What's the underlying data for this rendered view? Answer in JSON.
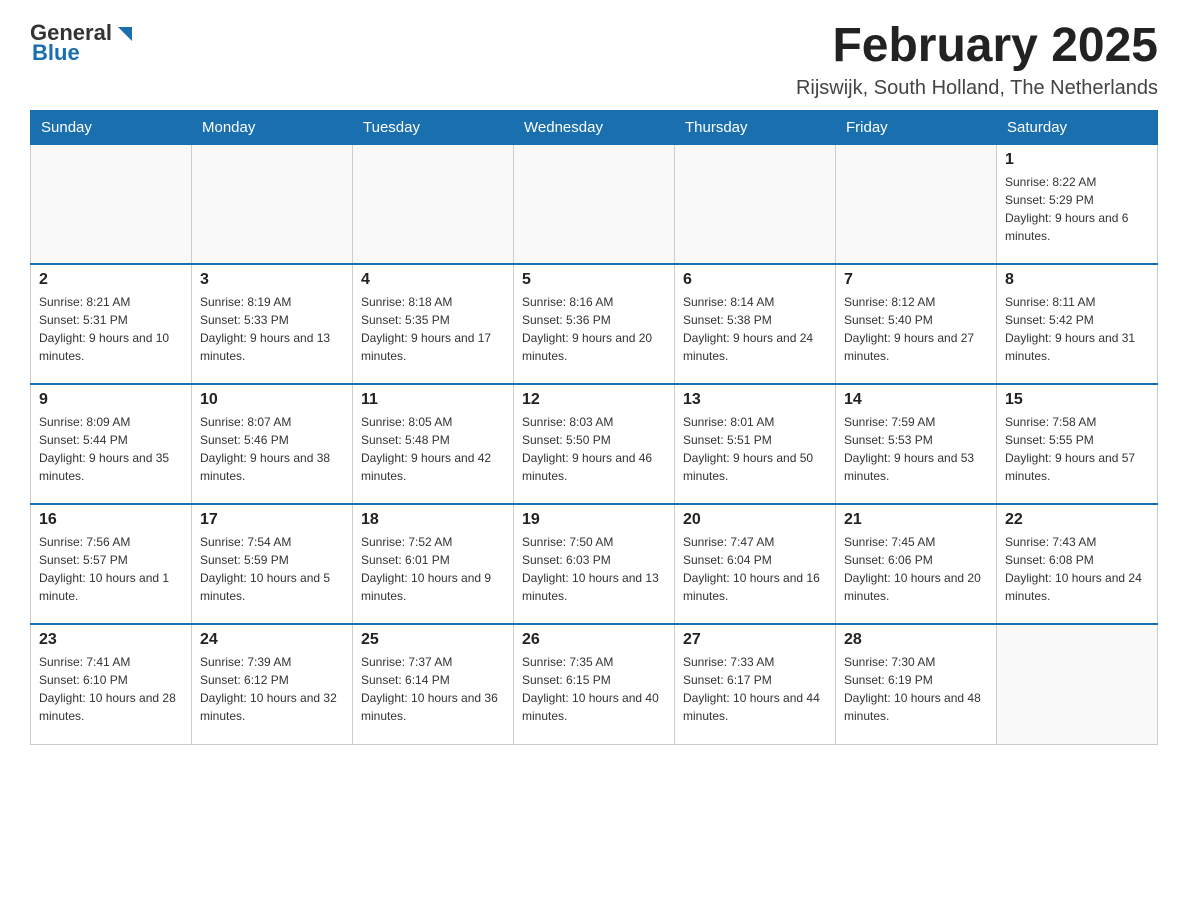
{
  "logo": {
    "general": "General",
    "blue": "Blue"
  },
  "title": "February 2025",
  "subtitle": "Rijswijk, South Holland, The Netherlands",
  "weekdays": [
    "Sunday",
    "Monday",
    "Tuesday",
    "Wednesday",
    "Thursday",
    "Friday",
    "Saturday"
  ],
  "weeks": [
    [
      {
        "day": "",
        "sunrise": "",
        "sunset": "",
        "daylight": ""
      },
      {
        "day": "",
        "sunrise": "",
        "sunset": "",
        "daylight": ""
      },
      {
        "day": "",
        "sunrise": "",
        "sunset": "",
        "daylight": ""
      },
      {
        "day": "",
        "sunrise": "",
        "sunset": "",
        "daylight": ""
      },
      {
        "day": "",
        "sunrise": "",
        "sunset": "",
        "daylight": ""
      },
      {
        "day": "",
        "sunrise": "",
        "sunset": "",
        "daylight": ""
      },
      {
        "day": "1",
        "sunrise": "Sunrise: 8:22 AM",
        "sunset": "Sunset: 5:29 PM",
        "daylight": "Daylight: 9 hours and 6 minutes."
      }
    ],
    [
      {
        "day": "2",
        "sunrise": "Sunrise: 8:21 AM",
        "sunset": "Sunset: 5:31 PM",
        "daylight": "Daylight: 9 hours and 10 minutes."
      },
      {
        "day": "3",
        "sunrise": "Sunrise: 8:19 AM",
        "sunset": "Sunset: 5:33 PM",
        "daylight": "Daylight: 9 hours and 13 minutes."
      },
      {
        "day": "4",
        "sunrise": "Sunrise: 8:18 AM",
        "sunset": "Sunset: 5:35 PM",
        "daylight": "Daylight: 9 hours and 17 minutes."
      },
      {
        "day": "5",
        "sunrise": "Sunrise: 8:16 AM",
        "sunset": "Sunset: 5:36 PM",
        "daylight": "Daylight: 9 hours and 20 minutes."
      },
      {
        "day": "6",
        "sunrise": "Sunrise: 8:14 AM",
        "sunset": "Sunset: 5:38 PM",
        "daylight": "Daylight: 9 hours and 24 minutes."
      },
      {
        "day": "7",
        "sunrise": "Sunrise: 8:12 AM",
        "sunset": "Sunset: 5:40 PM",
        "daylight": "Daylight: 9 hours and 27 minutes."
      },
      {
        "day": "8",
        "sunrise": "Sunrise: 8:11 AM",
        "sunset": "Sunset: 5:42 PM",
        "daylight": "Daylight: 9 hours and 31 minutes."
      }
    ],
    [
      {
        "day": "9",
        "sunrise": "Sunrise: 8:09 AM",
        "sunset": "Sunset: 5:44 PM",
        "daylight": "Daylight: 9 hours and 35 minutes."
      },
      {
        "day": "10",
        "sunrise": "Sunrise: 8:07 AM",
        "sunset": "Sunset: 5:46 PM",
        "daylight": "Daylight: 9 hours and 38 minutes."
      },
      {
        "day": "11",
        "sunrise": "Sunrise: 8:05 AM",
        "sunset": "Sunset: 5:48 PM",
        "daylight": "Daylight: 9 hours and 42 minutes."
      },
      {
        "day": "12",
        "sunrise": "Sunrise: 8:03 AM",
        "sunset": "Sunset: 5:50 PM",
        "daylight": "Daylight: 9 hours and 46 minutes."
      },
      {
        "day": "13",
        "sunrise": "Sunrise: 8:01 AM",
        "sunset": "Sunset: 5:51 PM",
        "daylight": "Daylight: 9 hours and 50 minutes."
      },
      {
        "day": "14",
        "sunrise": "Sunrise: 7:59 AM",
        "sunset": "Sunset: 5:53 PM",
        "daylight": "Daylight: 9 hours and 53 minutes."
      },
      {
        "day": "15",
        "sunrise": "Sunrise: 7:58 AM",
        "sunset": "Sunset: 5:55 PM",
        "daylight": "Daylight: 9 hours and 57 minutes."
      }
    ],
    [
      {
        "day": "16",
        "sunrise": "Sunrise: 7:56 AM",
        "sunset": "Sunset: 5:57 PM",
        "daylight": "Daylight: 10 hours and 1 minute."
      },
      {
        "day": "17",
        "sunrise": "Sunrise: 7:54 AM",
        "sunset": "Sunset: 5:59 PM",
        "daylight": "Daylight: 10 hours and 5 minutes."
      },
      {
        "day": "18",
        "sunrise": "Sunrise: 7:52 AM",
        "sunset": "Sunset: 6:01 PM",
        "daylight": "Daylight: 10 hours and 9 minutes."
      },
      {
        "day": "19",
        "sunrise": "Sunrise: 7:50 AM",
        "sunset": "Sunset: 6:03 PM",
        "daylight": "Daylight: 10 hours and 13 minutes."
      },
      {
        "day": "20",
        "sunrise": "Sunrise: 7:47 AM",
        "sunset": "Sunset: 6:04 PM",
        "daylight": "Daylight: 10 hours and 16 minutes."
      },
      {
        "day": "21",
        "sunrise": "Sunrise: 7:45 AM",
        "sunset": "Sunset: 6:06 PM",
        "daylight": "Daylight: 10 hours and 20 minutes."
      },
      {
        "day": "22",
        "sunrise": "Sunrise: 7:43 AM",
        "sunset": "Sunset: 6:08 PM",
        "daylight": "Daylight: 10 hours and 24 minutes."
      }
    ],
    [
      {
        "day": "23",
        "sunrise": "Sunrise: 7:41 AM",
        "sunset": "Sunset: 6:10 PM",
        "daylight": "Daylight: 10 hours and 28 minutes."
      },
      {
        "day": "24",
        "sunrise": "Sunrise: 7:39 AM",
        "sunset": "Sunset: 6:12 PM",
        "daylight": "Daylight: 10 hours and 32 minutes."
      },
      {
        "day": "25",
        "sunrise": "Sunrise: 7:37 AM",
        "sunset": "Sunset: 6:14 PM",
        "daylight": "Daylight: 10 hours and 36 minutes."
      },
      {
        "day": "26",
        "sunrise": "Sunrise: 7:35 AM",
        "sunset": "Sunset: 6:15 PM",
        "daylight": "Daylight: 10 hours and 40 minutes."
      },
      {
        "day": "27",
        "sunrise": "Sunrise: 7:33 AM",
        "sunset": "Sunset: 6:17 PM",
        "daylight": "Daylight: 10 hours and 44 minutes."
      },
      {
        "day": "28",
        "sunrise": "Sunrise: 7:30 AM",
        "sunset": "Sunset: 6:19 PM",
        "daylight": "Daylight: 10 hours and 48 minutes."
      },
      {
        "day": "",
        "sunrise": "",
        "sunset": "",
        "daylight": ""
      }
    ]
  ]
}
